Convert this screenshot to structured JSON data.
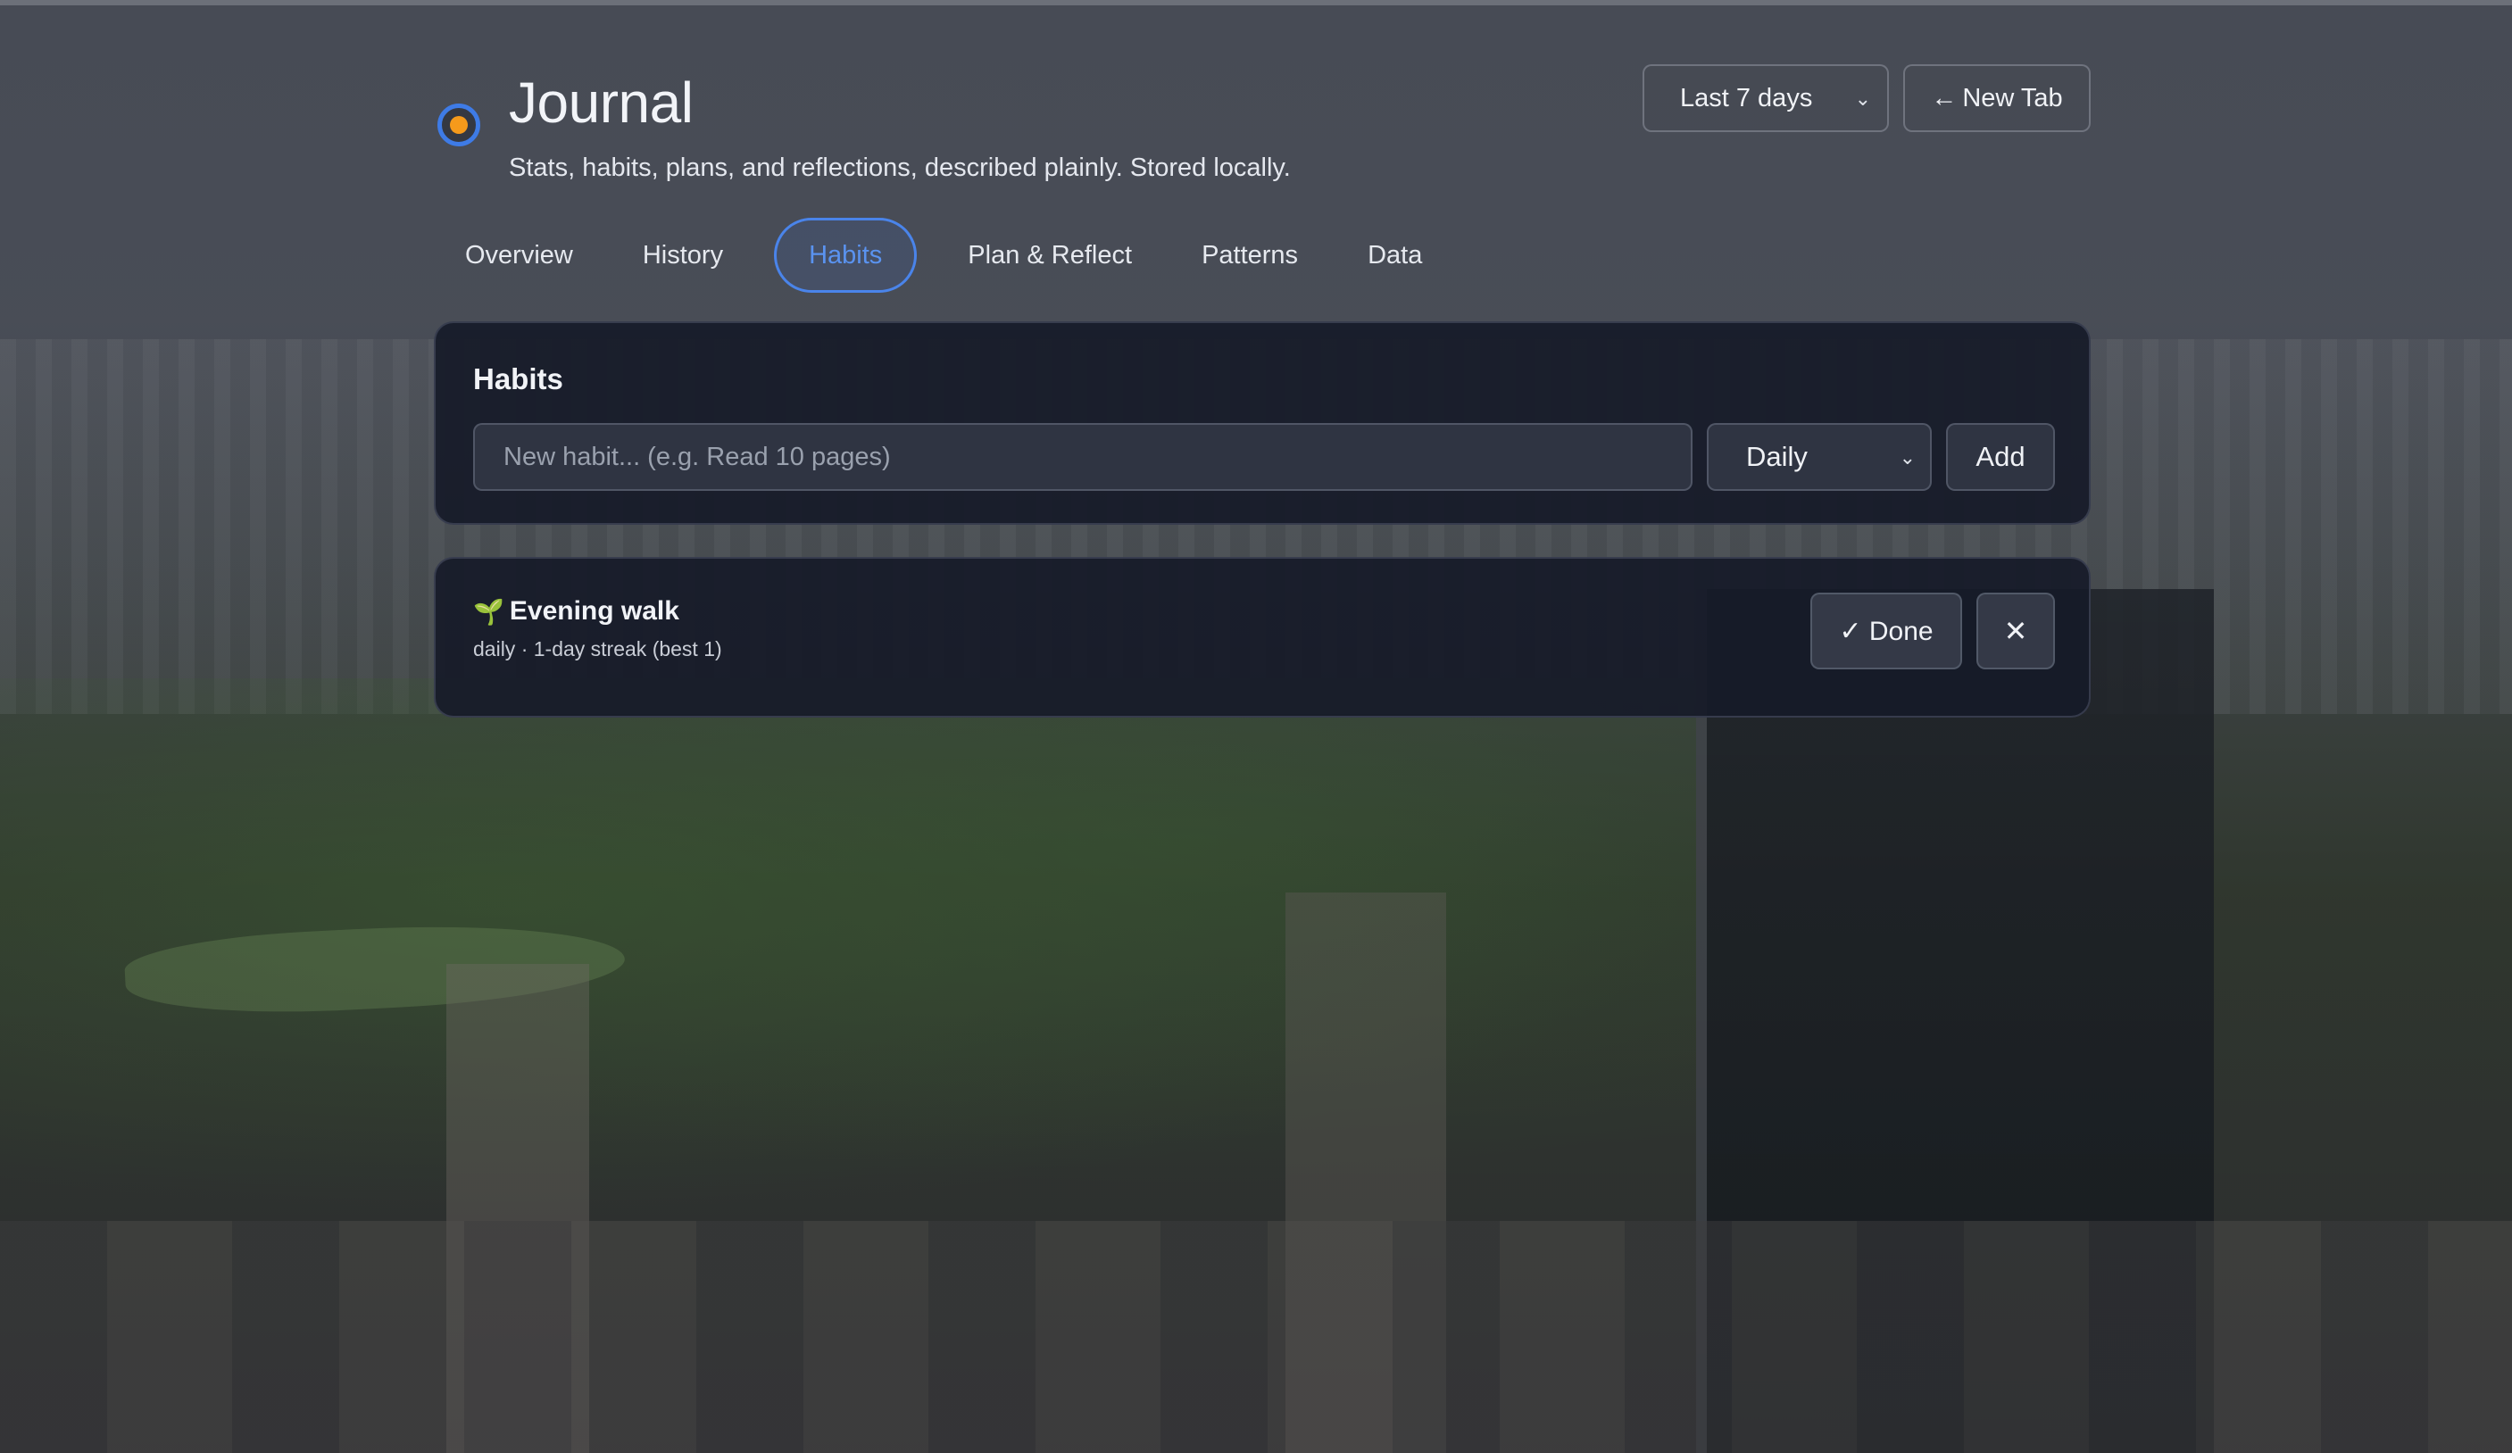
{
  "header": {
    "title": "Journal",
    "subtitle": "Stats, habits, plans, and reflections, described plainly. Stored locally.",
    "range_select": {
      "value": "Last 7 days"
    },
    "new_tab_button": {
      "arrow": "←",
      "label": "New Tab"
    }
  },
  "tabs": [
    {
      "label": "Overview",
      "active": false
    },
    {
      "label": "History",
      "active": false
    },
    {
      "label": "Habits",
      "active": true
    },
    {
      "label": "Plan & Reflect",
      "active": false
    },
    {
      "label": "Patterns",
      "active": false
    },
    {
      "label": "Data",
      "active": false
    }
  ],
  "habits_panel": {
    "title": "Habits",
    "input": {
      "placeholder": "New habit... (e.g. Read 10 pages)",
      "value": ""
    },
    "frequency_select": {
      "value": "Daily"
    },
    "add_label": "Add"
  },
  "habit_items": [
    {
      "icon": "sprout-icon",
      "emoji": "🌱",
      "name": "Evening walk",
      "meta": "daily · 1-day streak (best 1)",
      "done_label": "✓ Done",
      "remove_label": "✕"
    }
  ],
  "colors": {
    "accent": "#4a84ea",
    "brand_ring": "#3e7be6",
    "brand_core": "#f59a1b",
    "card_bg": "#161a28"
  }
}
